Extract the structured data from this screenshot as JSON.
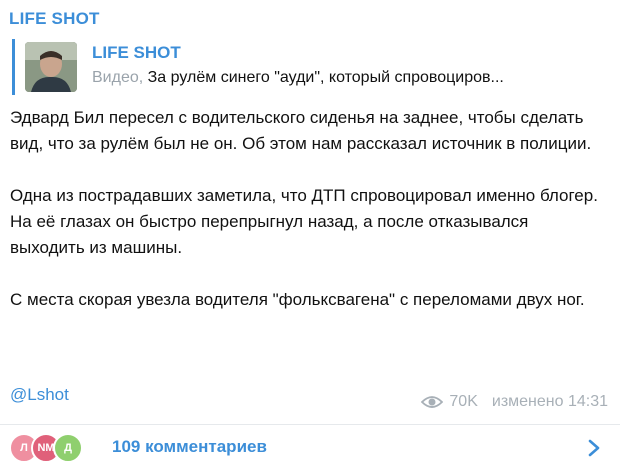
{
  "post": {
    "channel_name": "LIFE SHOT",
    "reply": {
      "channel_name": "LIFE SHOT",
      "media_kind": "Видео,",
      "text": "За рулём синего \"ауди\", который спровоциров..."
    },
    "paragraphs": [
      "Эдвард Бил пересел с водительского сиденья на заднее, чтобы сделать вид, что за рулём был не он. Об этом нам рассказал источник в полиции.",
      "Одна из пострадавших заметила, что ДТП спровоцировал именно блогер. На её глазах он быстро перепрыгнул назад, а после отказывался выходить из машины.",
      "С места скорая увезла водителя \"фольксвагена\" с переломами двух ног."
    ],
    "hashtag": "@Lshot",
    "views": "70K",
    "edited_label": "изменено 14:31",
    "icons": {
      "views": "eye-icon",
      "open": "chevron-right-icon"
    }
  },
  "comments": {
    "label": "109 комментариев",
    "avatars": [
      {
        "initials": "Л",
        "color": "#ef8fa0"
      },
      {
        "initials": "NM",
        "color": "#e0607a"
      },
      {
        "initials": "Д",
        "color": "#8fcf6e"
      }
    ]
  },
  "colors": {
    "accent": "#3c8ed8",
    "meta": "#a8b0b7"
  }
}
